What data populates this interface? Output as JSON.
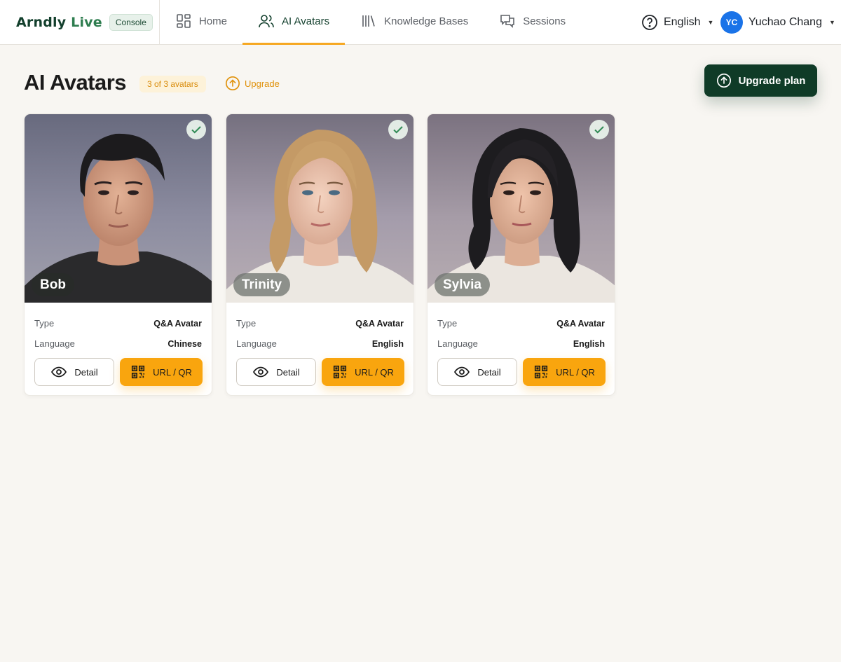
{
  "brand": {
    "logo_prefix": "Arndly",
    "logo_suffix": "Live",
    "badge": "Console"
  },
  "nav": {
    "items": [
      {
        "label": "Home",
        "icon": "grid-icon"
      },
      {
        "label": "AI Avatars",
        "icon": "users-icon"
      },
      {
        "label": "Knowledge Bases",
        "icon": "books-icon"
      },
      {
        "label": "Sessions",
        "icon": "chat-icon"
      }
    ],
    "active": "AI Avatars"
  },
  "header": {
    "language": "English",
    "user_initials": "YC",
    "user_name": "Yuchao Chang"
  },
  "page": {
    "title": "AI Avatars",
    "quota": "3 of 3 avatars",
    "upgrade_link": "Upgrade",
    "upgrade_button": "Upgrade plan"
  },
  "labels": {
    "type": "Type",
    "language": "Language",
    "detail": "Detail",
    "url_qr": "URL / QR"
  },
  "avatars": [
    {
      "name": "Bob",
      "type": "Q&A Avatar",
      "language": "Chinese",
      "selected": true
    },
    {
      "name": "Trinity",
      "type": "Q&A Avatar",
      "language": "English",
      "selected": true
    },
    {
      "name": "Sylvia",
      "type": "Q&A Avatar",
      "language": "English",
      "selected": true
    }
  ],
  "colors": {
    "primary_dark": "#0f3b27",
    "accent_orange": "#f9a50e",
    "nav_underline": "#f6a823",
    "background": "#f8f6f2",
    "user_avatar": "#1a73e8"
  }
}
